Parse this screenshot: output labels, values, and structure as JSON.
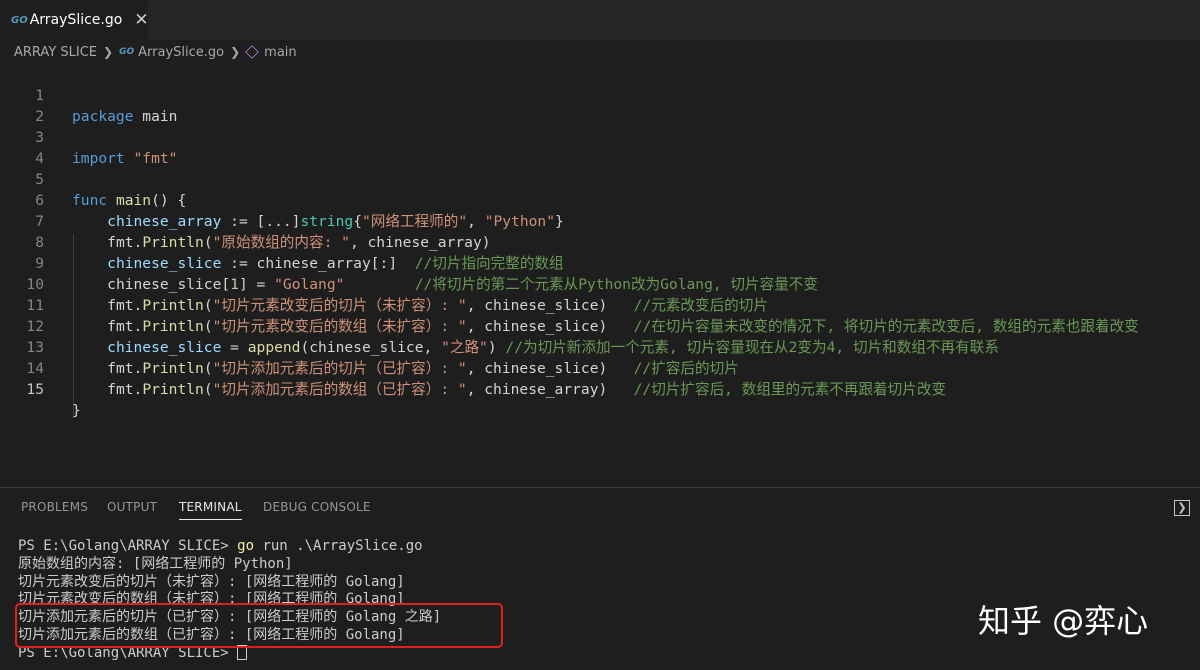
{
  "tab": {
    "badge": "GO",
    "label": "ArraySlice.go",
    "close": "✕"
  },
  "breadcrumb": {
    "folder": "ARRAY SLICE",
    "file": "ArraySlice.go",
    "symbol": "main",
    "badge": "GO"
  },
  "editor": {
    "line_numbers": [
      "1",
      "2",
      "3",
      "4",
      "5",
      "6",
      "7",
      "8",
      "9",
      "10",
      "11",
      "12",
      "13",
      "14",
      "15"
    ],
    "active_line": "15"
  },
  "code": {
    "l1_kw": "package",
    "l1_rest": " main",
    "l3_kw": "import",
    "l3_str": "\"fmt\"",
    "l5_kw": "func",
    "l5_fn": "main",
    "l5_rest": "() {",
    "l6_var": "chinese_array",
    "l6_op": " := [...]",
    "l6_type": "string",
    "l6_b1": "{",
    "l6_s1": "\"网络工程师的\"",
    "l6_c": ", ",
    "l6_s2": "\"Python\"",
    "l6_b2": "}",
    "l7_pkg": "fmt.",
    "l7_fn": "Println",
    "l7_p1": "(",
    "l7_str": "\"原始数组的内容: \"",
    "l7_rest": ", chinese_array)",
    "l8_var": "chinese_slice",
    "l8_rest": " := chinese_array[:]  ",
    "l8_cm": "//切片指向完整的数组",
    "l9_a": "chinese_slice[",
    "l9_num": "1",
    "l9_b": "] = ",
    "l9_str": "\"Golang\"",
    "l9_sp": "        ",
    "l9_cm": "//将切片的第二个元素从Python改为Golang, 切片容量不变",
    "l10_pkg": "fmt.",
    "l10_fn": "Println",
    "l10_p1": "(",
    "l10_str": "\"切片元素改变后的切片（未扩容）: \"",
    "l10_rest": ", chinese_slice)   ",
    "l10_cm": "//元素改变后的切片",
    "l11_pkg": "fmt.",
    "l11_fn": "Println",
    "l11_p1": "(",
    "l11_str": "\"切片元素改变后的数组（未扩容）: \"",
    "l11_rest": ", chinese_slice)   ",
    "l11_cm": "//在切片容量未改变的情况下, 将切片的元素改变后, 数组的元素也跟着改变",
    "l12_var": "chinese_slice",
    "l12_op": " = ",
    "l12_fn": "append",
    "l12_a": "(chinese_slice, ",
    "l12_str": "\"之路\"",
    "l12_b": ") ",
    "l12_cm": "//为切片新添加一个元素, 切片容量现在从2变为4, 切片和数组不再有联系",
    "l13_pkg": "fmt.",
    "l13_fn": "Println",
    "l13_p1": "(",
    "l13_str": "\"切片添加元素后的切片（已扩容）: \"",
    "l13_rest": ", chinese_slice)   ",
    "l13_cm": "//扩容后的切片",
    "l14_pkg": "fmt.",
    "l14_fn": "Println",
    "l14_p1": "(",
    "l14_str": "\"切片添加元素后的数组（已扩容）: \"",
    "l14_rest": ", chinese_array)   ",
    "l14_cm": "//切片扩容后, 数组里的元素不再跟着切片改变",
    "l15": "}"
  },
  "panel": {
    "tabs": [
      "PROBLEMS",
      "OUTPUT",
      "TERMINAL",
      "DEBUG CONSOLE"
    ],
    "active_tab": "TERMINAL",
    "maximize_icon": "❯"
  },
  "terminal": {
    "prompt1": "PS E:\\Golang\\ARRAY SLICE> ",
    "cmd_go": "go",
    "cmd_rest": " run .\\ArraySlice.go",
    "out1": "原始数组的内容: [网络工程师的 Python]",
    "out2": "切片元素改变后的切片（未扩容）: [网络工程师的 Golang]",
    "out3": "切片元素改变后的数组（未扩容）: [网络工程师的 Golang]",
    "out4": "切片添加元素后的切片（已扩容）: [网络工程师的 Golang 之路]",
    "out5": "切片添加元素后的数组（已扩容）: [网络工程师的 Golang]",
    "prompt2": "PS E:\\Golang\\ARRAY SLICE> "
  },
  "watermark": "知乎 @弈心",
  "colors": {
    "highlight_box": "#e02020",
    "keyword": "#569cd6",
    "string": "#ce9178",
    "comment": "#6a9955"
  }
}
